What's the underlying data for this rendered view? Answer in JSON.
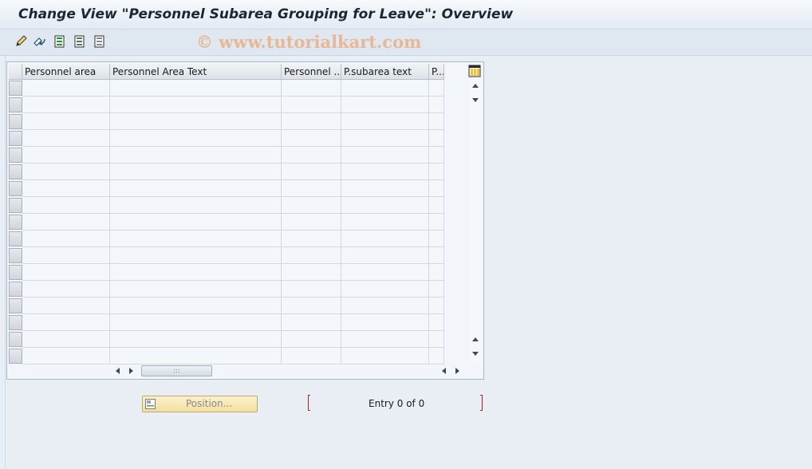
{
  "window": {
    "title": "Change View \"Personnel Subarea Grouping for Leave\": Overview",
    "watermark": "© www.tutorialkart.com"
  },
  "toolbar": {
    "buttons": [
      {
        "icon": "edit-pencil-icon"
      },
      {
        "icon": "undo-change-icon"
      },
      {
        "icon": "select-all-icon"
      },
      {
        "icon": "select-block-icon"
      },
      {
        "icon": "deselect-all-icon"
      }
    ]
  },
  "table": {
    "columns": [
      "Personnel area",
      "Personnel Area Text",
      "Personnel ...",
      "P.subarea text",
      "P..."
    ],
    "row_count": 17,
    "rows": []
  },
  "footer": {
    "position_button": "Position...",
    "entry_text": "Entry 0 of 0"
  },
  "colors": {
    "background": "#e8eef5",
    "button_yellow": "#f3df9d",
    "bracket_red": "#c21b1b"
  }
}
